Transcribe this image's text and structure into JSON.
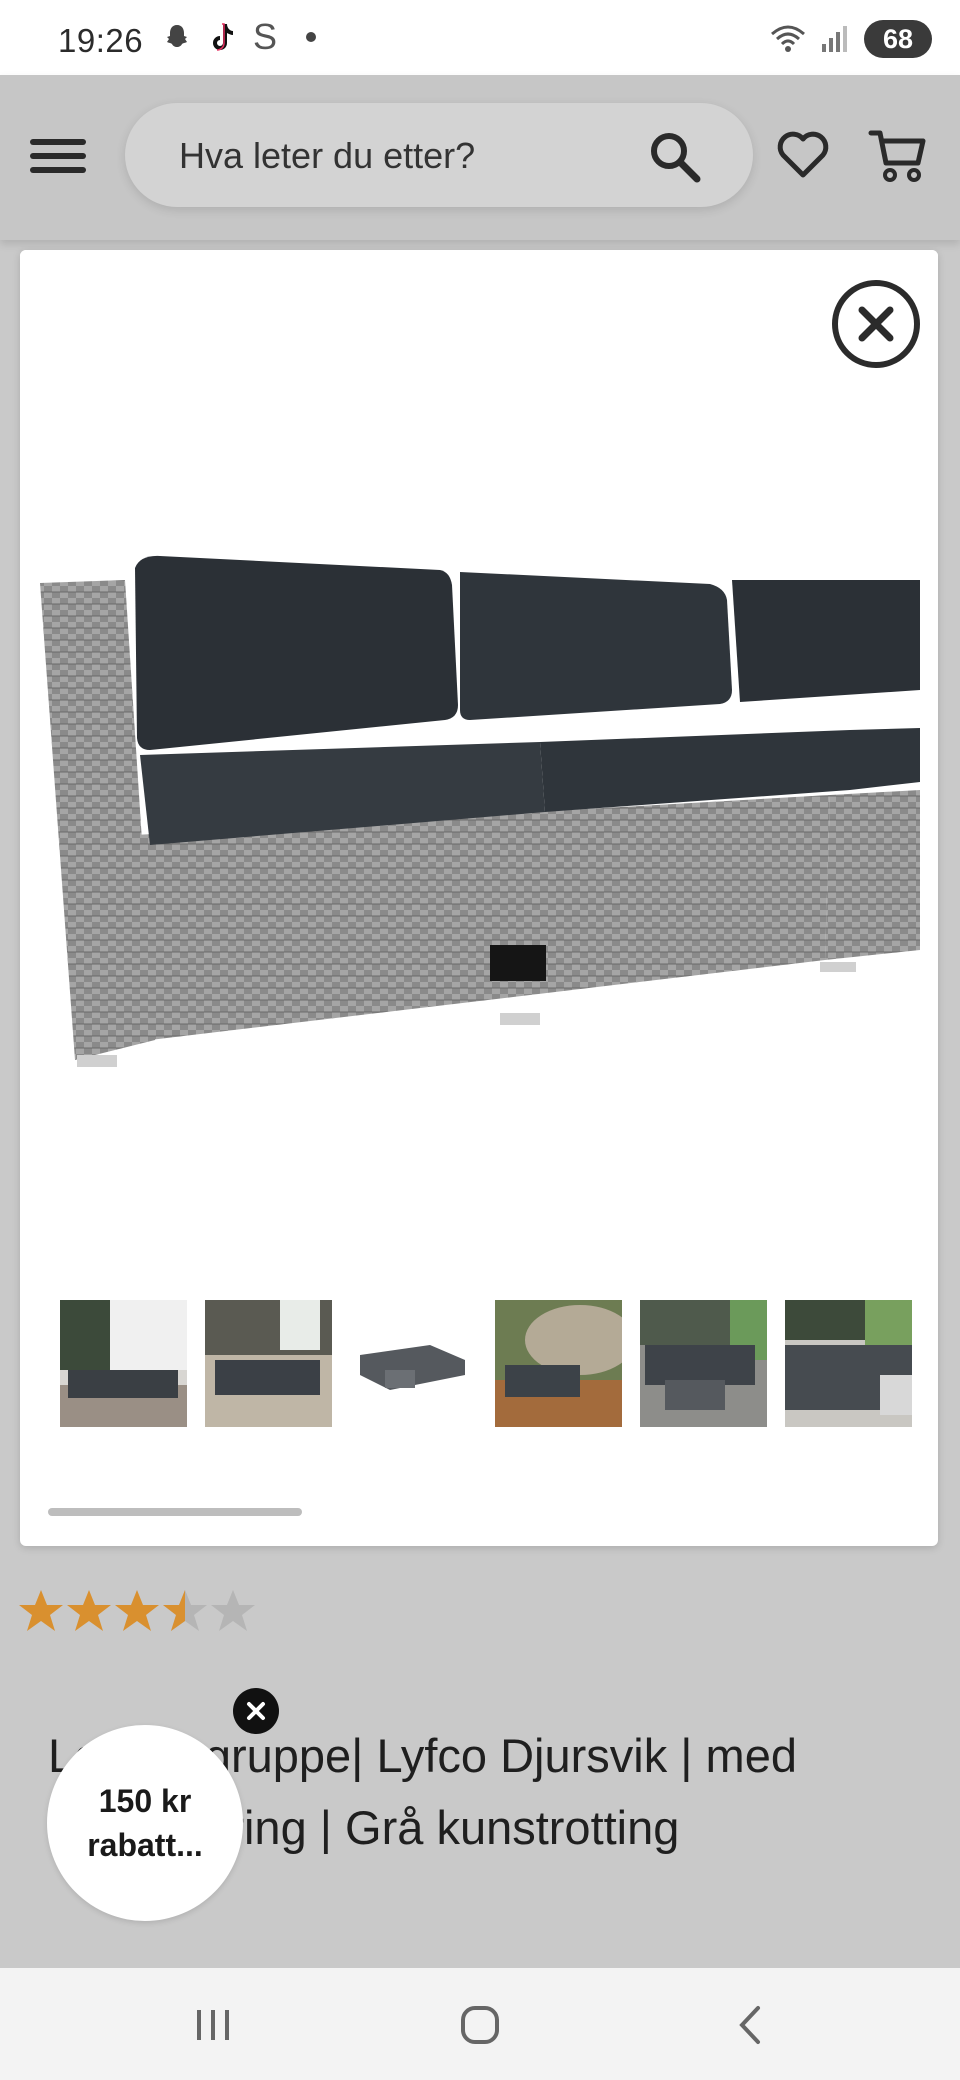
{
  "status_bar": {
    "time": "19:26",
    "battery": "68",
    "icons": [
      "snapchat-icon",
      "tiktok-icon",
      "s-app-icon",
      "wifi-icon",
      "signal-icon"
    ],
    "s_glyph": "S"
  },
  "header": {
    "search_placeholder": "Hva leter du etter?",
    "icons": [
      "menu-icon",
      "search-icon",
      "heart-icon",
      "cart-icon"
    ]
  },
  "gallery": {
    "thumbnail_count": 6,
    "close_icon": "close-icon"
  },
  "rating": {
    "value": 3.5,
    "max": 5
  },
  "product": {
    "title": "Loungegruppe| Lyfco Djursvik | med oppbevaring | Grå kunstrotting"
  },
  "discount": {
    "line1": "150 kr",
    "line2": "rabatt..."
  },
  "colors": {
    "star_filled": "#d9902f",
    "star_empty": "#b5b5b5",
    "cushion": "#2f353b",
    "rattan": "#8c8c8c"
  }
}
